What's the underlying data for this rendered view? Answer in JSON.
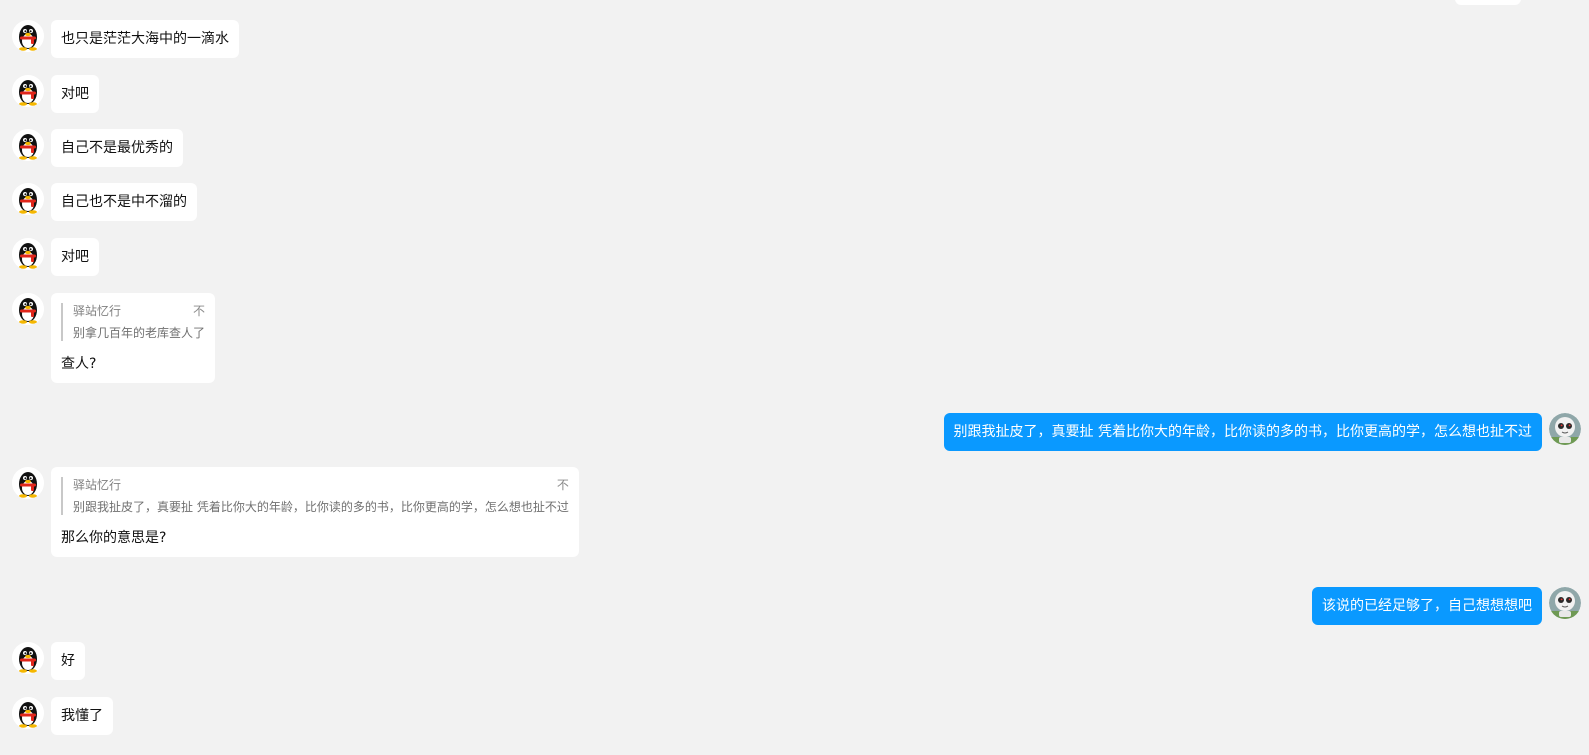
{
  "contact_name": "驿站忆行",
  "messages": [
    {
      "side": "left",
      "text": "也只是茫茫大海中的一滴水"
    },
    {
      "side": "left",
      "text": "对吧"
    },
    {
      "side": "left",
      "text": "自己不是最优秀的"
    },
    {
      "side": "left",
      "text": "自己也不是中不溜的"
    },
    {
      "side": "left",
      "text": "对吧"
    },
    {
      "side": "left",
      "quote": {
        "sender": "驿站忆行",
        "more": "不",
        "text": "别拿几百年的老库查人了"
      },
      "text": "查人?"
    },
    {
      "side": "right",
      "text": "别跟我扯皮了，真要扯 凭着比你大的年龄，比你读的多的书，比你更高的学，怎么想也扯不过"
    },
    {
      "side": "left",
      "quote": {
        "sender": "驿站忆行",
        "more": "不",
        "text": "别跟我扯皮了，真要扯 凭着比你大的年龄，比你读的多的书，比你更高的学，怎么想也扯不过"
      },
      "text": "那么你的意思是?"
    },
    {
      "side": "right",
      "text": "该说的已经足够了，自己想想想吧"
    },
    {
      "side": "left",
      "text": "好"
    },
    {
      "side": "left",
      "text": "我懂了"
    }
  ],
  "colors": {
    "background": "#f2f2f2",
    "incoming_bubble": "#ffffff",
    "outgoing_bubble": "#0a99ff"
  },
  "icons": {
    "contact_avatar": "penguin-avatar-icon",
    "self_avatar": "cartoon-face-avatar-icon"
  }
}
